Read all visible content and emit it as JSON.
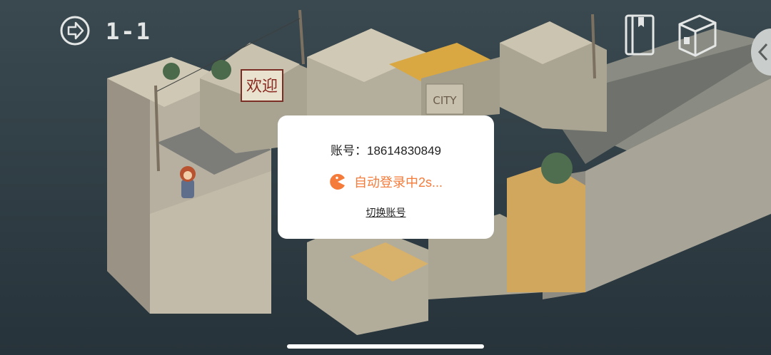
{
  "hud": {
    "level_label": "1-1",
    "icons": {
      "back": "arrow-right-circle-icon",
      "journal": "book-icon",
      "inventory": "box-icon",
      "side_panel": "chevron-left-icon"
    }
  },
  "scene": {
    "signs": {
      "welcome": "欢迎",
      "city": "CITY"
    }
  },
  "dialog": {
    "account_label": "账号：",
    "account_value": "18614830849",
    "status_text": "自动登录中2s...",
    "switch_label": "切换账号",
    "accent_color": "#f47b3a"
  }
}
